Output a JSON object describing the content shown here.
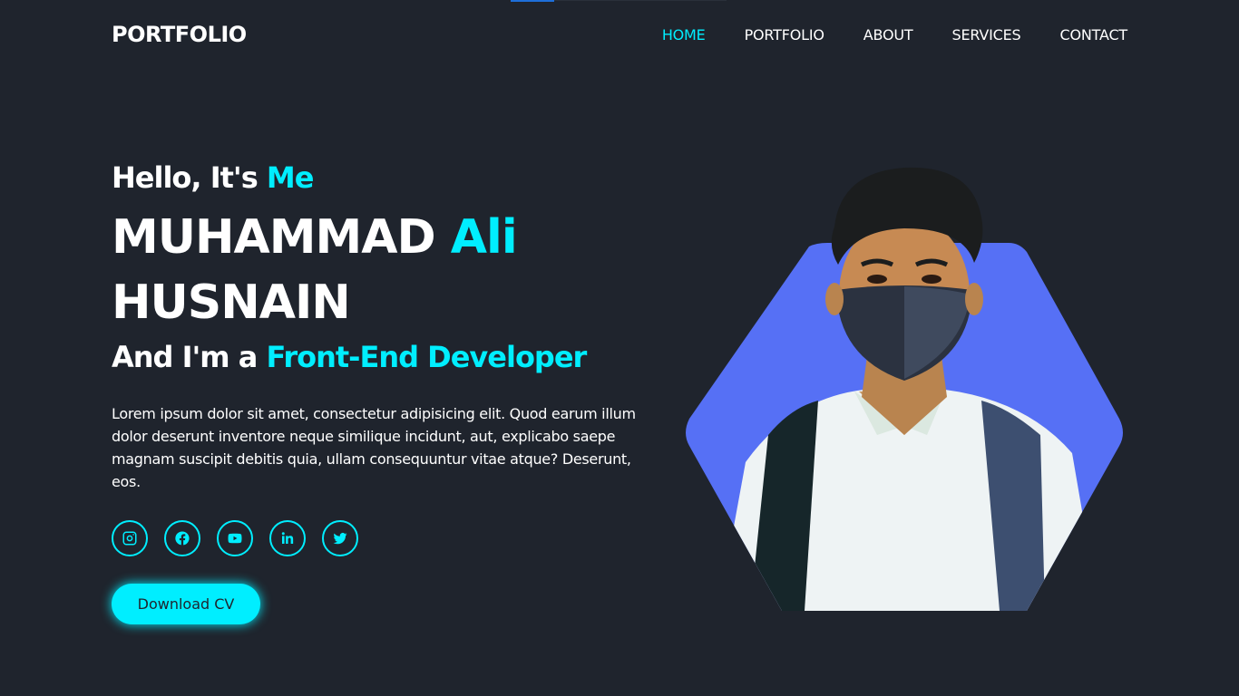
{
  "header": {
    "logo": "PORTFOLIO",
    "nav": [
      {
        "label": "HOME",
        "active": true
      },
      {
        "label": "PORTFOLIO",
        "active": false
      },
      {
        "label": "ABOUT",
        "active": false
      },
      {
        "label": "SERVICES",
        "active": false
      },
      {
        "label": "CONTACT",
        "active": false
      }
    ]
  },
  "hero": {
    "greeting_prefix": "Hello, It's",
    "greeting_accent": "Me",
    "name_first": "MUHAMMAD",
    "name_accent": "Ali",
    "name_last": "HUSNAIN",
    "role_prefix": "And I'm a",
    "role_accent": "Front-End Developer",
    "description": "Lorem ipsum dolor sit amet, consectetur adipisicing elit. Quod earum illum dolor deserunt inventore neque similique incidunt, aut, explicabo saepe magnam suscipit debitis quia, ullam consequuntur vitae atque? Deserunt, eos.",
    "social": [
      "instagram-icon",
      "facebook-icon",
      "youtube-icon",
      "linkedin-icon",
      "twitter-icon"
    ],
    "cta_label": "Download CV"
  },
  "colors": {
    "background": "#1f242d",
    "accent": "#00eeff",
    "hexagon": "#5670f5"
  }
}
